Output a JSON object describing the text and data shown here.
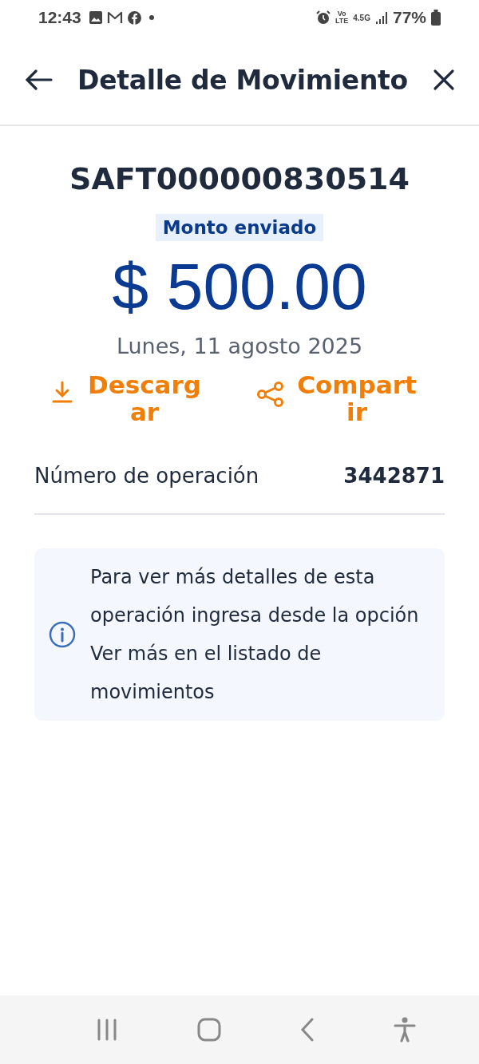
{
  "status_bar": {
    "time": "12:43",
    "network_top": "Vo",
    "network_bottom": "LTE",
    "data_type": "4.5G",
    "battery": "77%"
  },
  "header": {
    "title": "Detalle de Movimiento"
  },
  "reference": "SAFT000000830514",
  "amount_label": "Monto enviado",
  "amount": "$ 500.00",
  "date": "Lunes, 11 agosto 2025",
  "actions": [
    {
      "kind": "download",
      "label": "Descargar"
    },
    {
      "kind": "share",
      "label": "Compartir"
    }
  ],
  "details": [
    {
      "label": "Número de operación",
      "value": "3442871"
    }
  ],
  "info": {
    "text": "Para ver más detalles de esta operación ingresa desde la opción Ver más en el listado de movimientos"
  }
}
